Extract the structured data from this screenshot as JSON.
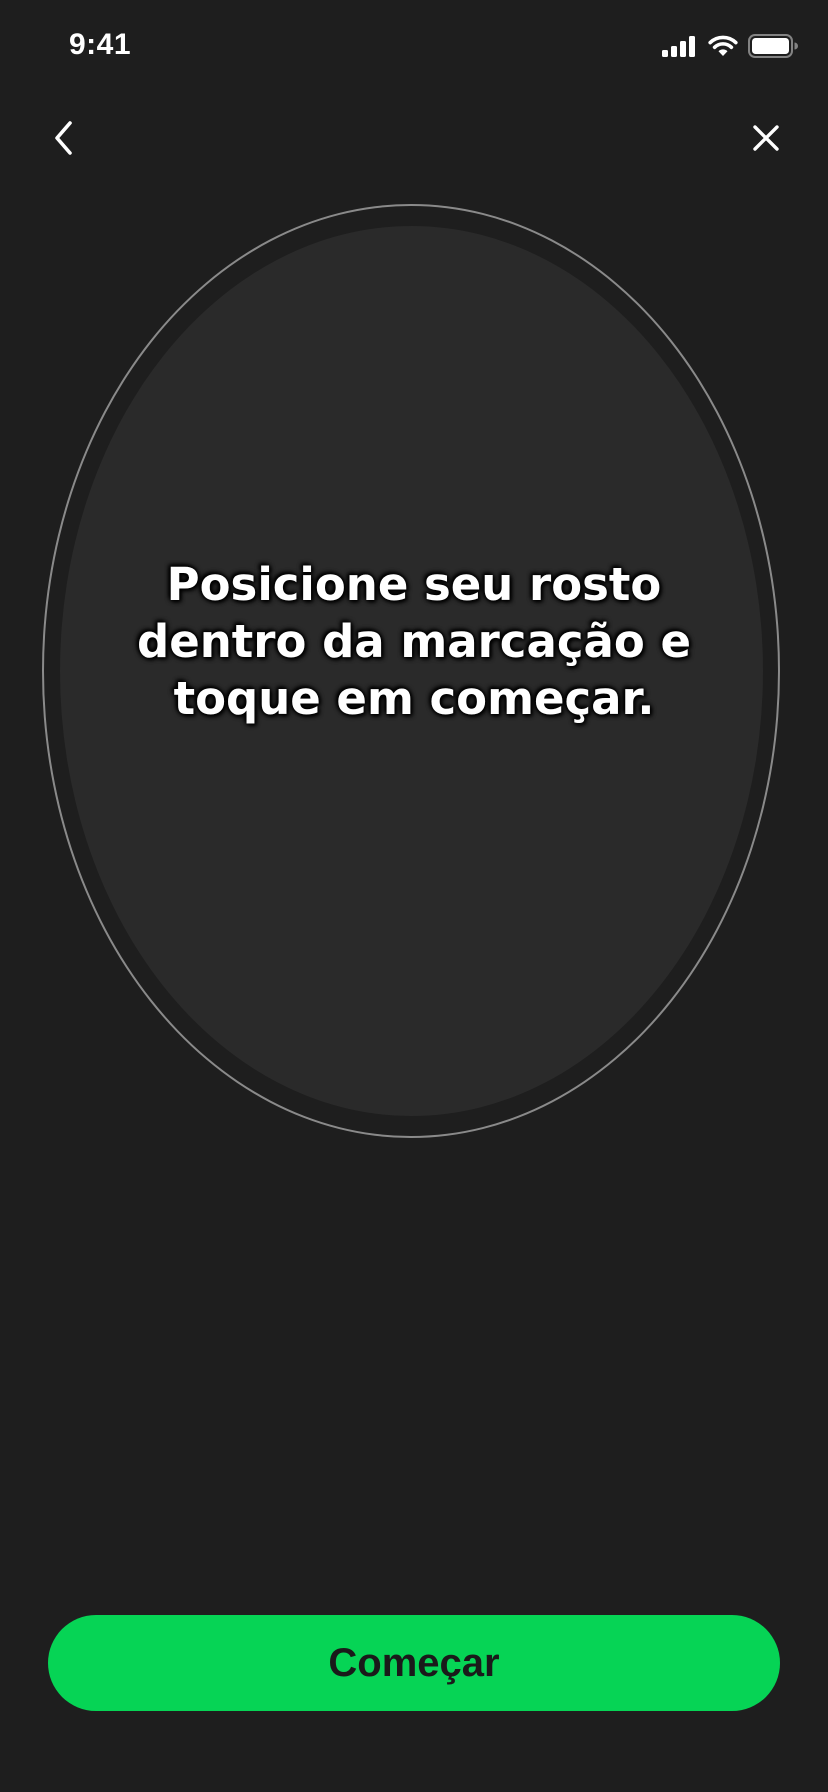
{
  "status_bar": {
    "time": "9:41",
    "icons": [
      "cellular-signal-icon",
      "wifi-icon",
      "battery-icon"
    ]
  },
  "nav": {
    "back_icon": "chevron-left-icon",
    "close_icon": "close-icon"
  },
  "instruction": {
    "text": "Posicione seu rosto\ndentro da marcação e\ntoque em começar."
  },
  "cta": {
    "label": "Começar"
  },
  "colors": {
    "background": "#1e1e1e",
    "face_area": "#2a2a2a",
    "frame_outline": "#8a8a8a",
    "accent": "#06d455",
    "button_text": "#1a1a1a"
  }
}
